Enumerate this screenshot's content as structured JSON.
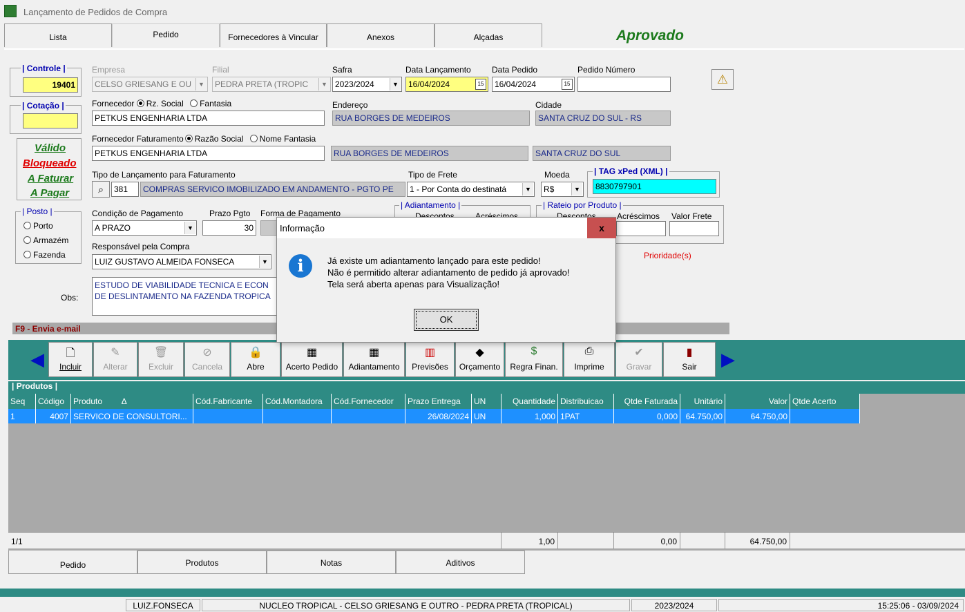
{
  "window": {
    "title": "Lançamento de Pedidos de Compra"
  },
  "tabs": [
    {
      "label": "Lista"
    },
    {
      "label": "Pedido"
    },
    {
      "label": "Fornecedores à Vincular"
    },
    {
      "label": "Anexos"
    },
    {
      "label": "Alçadas"
    }
  ],
  "status_label": "Aprovado",
  "form": {
    "controle": {
      "label": "| Controle |",
      "value": "19401"
    },
    "cotacao": {
      "label": "| Cotação |",
      "value": ""
    },
    "empresa": {
      "label": "Empresa",
      "value": "CELSO GRIESANG E OU"
    },
    "filial": {
      "label": "Filial",
      "value": "PEDRA PRETA (TROPIC"
    },
    "safra": {
      "label": "Safra",
      "value": "2023/2024"
    },
    "data_lancamento": {
      "label": "Data Lançamento",
      "value": "16/04/2024"
    },
    "data_pedido": {
      "label": "Data Pedido",
      "value": "16/04/2024"
    },
    "pedido_numero": {
      "label": "Pedido Número",
      "value": ""
    },
    "fornecedor": {
      "label": "Fornecedor",
      "opt1": "Rz. Social",
      "opt2": "Fantasia",
      "value": "PETKUS ENGENHARIA LTDA"
    },
    "endereco": {
      "label": "Endereço",
      "value": "RUA BORGES DE MEDEIROS"
    },
    "cidade": {
      "label": "Cidade",
      "value": "SANTA CRUZ DO SUL - RS"
    },
    "forn_faturamento": {
      "label": "Fornecedor Faturamento",
      "opt1": "Razão Social",
      "opt2": "Nome Fantasia",
      "value": "PETKUS ENGENHARIA LTDA",
      "endereco": "RUA BORGES DE MEDEIROS",
      "cidade": "SANTA CRUZ DO SUL"
    },
    "status_links": {
      "valido": "Válido",
      "bloqueado": "Bloqueado",
      "a_faturar": "A Faturar",
      "a_pagar": "A Pagar"
    },
    "tipo_lancamento": {
      "label": "Tipo de Lançamento para Faturamento",
      "code": "381",
      "value": "COMPRAS SERVICO IMOBILIZADO EM ANDAMENTO - PGTO PE"
    },
    "tipo_frete": {
      "label": "Tipo de Frete",
      "value": "1 - Por Conta do destinatá"
    },
    "moeda": {
      "label": "Moeda",
      "value": "R$"
    },
    "tag_xped": {
      "label": "| TAG xPed (XML) |",
      "value": "8830797901"
    },
    "posto": {
      "label": "| Posto |",
      "options": [
        "Porto",
        "Armazém",
        "Fazenda"
      ]
    },
    "condicao_pagamento": {
      "label": "Condição de Pagamento",
      "value": "A PRAZO"
    },
    "prazo_pgto": {
      "label": "Prazo Pgto",
      "value": "30"
    },
    "forma_pagamento": {
      "label": "Forma de Pagamento"
    },
    "adiantamento": {
      "label": "| Adiantamento |",
      "descontos": "Descontos",
      "acrescimos": "Acréscimos"
    },
    "rateio": {
      "label": "| Rateio por Produto |",
      "descontos": "Descontos",
      "acrescimos": "Acréscimos",
      "valor_frete": "Valor Frete"
    },
    "responsavel": {
      "label": "Responsável pela Compra",
      "value": "LUIZ GUSTAVO ALMEIDA FONSECA"
    },
    "prioridade": "Prioridade(s)",
    "obs": {
      "label": "Obs:",
      "line1": "ESTUDO DE VIABILIDADE TECNICA E ECON",
      "line2": "DE DESLINTAMENTO NA FAZENDA TROPICA"
    },
    "f9_hint": "F9 - Envia e-mail"
  },
  "toolbar": {
    "incluir": "Incluir",
    "alterar": "Alterar",
    "excluir": "Excluir",
    "cancela": "Cancela",
    "abre": "Abre",
    "acerto_pedido": "Acerto Pedido",
    "adiantamento": "Adiantamento",
    "previsoes": "Previsões",
    "orcamento": "Orçamento",
    "regra_finan": "Regra Finan.",
    "imprime": "Imprime",
    "gravar": "Gravar",
    "sair": "Sair"
  },
  "grid": {
    "title": "| Produtos |",
    "columns": [
      "Seq",
      "Código",
      "Produto",
      "Cód.Fabricante",
      "Cód.Montadora",
      "Cód.Fornecedor",
      "Prazo Entrega",
      "UN",
      "Quantidade",
      "Distribuicao",
      "Qtde Faturada",
      "Unitário",
      "Valor",
      "Qtde Acerto"
    ],
    "sort_marker": "∆",
    "rows": [
      {
        "seq": "1",
        "codigo": "4007",
        "produto": "SERVICO DE CONSULTORI...",
        "cod_fab": "",
        "cod_mont": "",
        "cod_forn": "",
        "prazo": "26/08/2024",
        "un": "UN",
        "quantidade": "1,000",
        "distribuicao": "1PAT",
        "qtde_faturada": "0,000",
        "unitario": "64.750,00",
        "valor": "64.750,00",
        "qtde_acerto": ""
      }
    ],
    "footer": {
      "pos": "1/1",
      "quantidade": "1,00",
      "qtde_faturada": "0,00",
      "valor": "64.750,00"
    }
  },
  "bottom_tabs": [
    "Pedido",
    "Produtos",
    "Notas",
    "Aditivos"
  ],
  "statusbar": {
    "user": "LUIZ.FONSECA",
    "empresa": "NUCLEO TROPICAL - CELSO GRIESANG E OUTRO - PEDRA PRETA (TROPICAL)",
    "safra": "2023/2024",
    "datetime": "15:25:06 - 03/09/2024"
  },
  "dialog": {
    "title": "Informação",
    "close": "x",
    "line1": "Já existe um adiantamento lançado para este pedido!",
    "line2": "Não é permitido alterar adiantamento de pedido já aprovado!",
    "line3": "Tela será aberta apenas para Visualização!",
    "ok": "OK"
  },
  "colors": {
    "teal": "#2e8b84",
    "selection": "#1e90ff",
    "approved": "#1c7a1c",
    "link_red": "#e00000",
    "link_green": "#1c7a1c"
  }
}
